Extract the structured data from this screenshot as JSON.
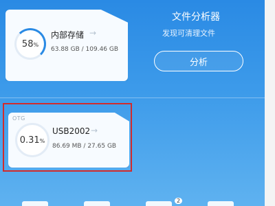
{
  "internal_storage": {
    "percent": "58",
    "percent_unit": "%",
    "label": "内部存储",
    "usage": "63.88 GB / 109.46 GB",
    "arrow": "→"
  },
  "usb_storage": {
    "tag": "OTG",
    "percent": "0.31",
    "percent_unit": "%",
    "label": "USB2002",
    "usage": "86.69 MB / 27.65 GB",
    "arrow": "→"
  },
  "analyzer": {
    "title": "文件分析器",
    "subtitle": "发现可清理文件",
    "button_label": "分析"
  },
  "bottom_badge": "2",
  "colors": {
    "accent": "#2a8ae4",
    "highlight": "#d22b2b"
  }
}
